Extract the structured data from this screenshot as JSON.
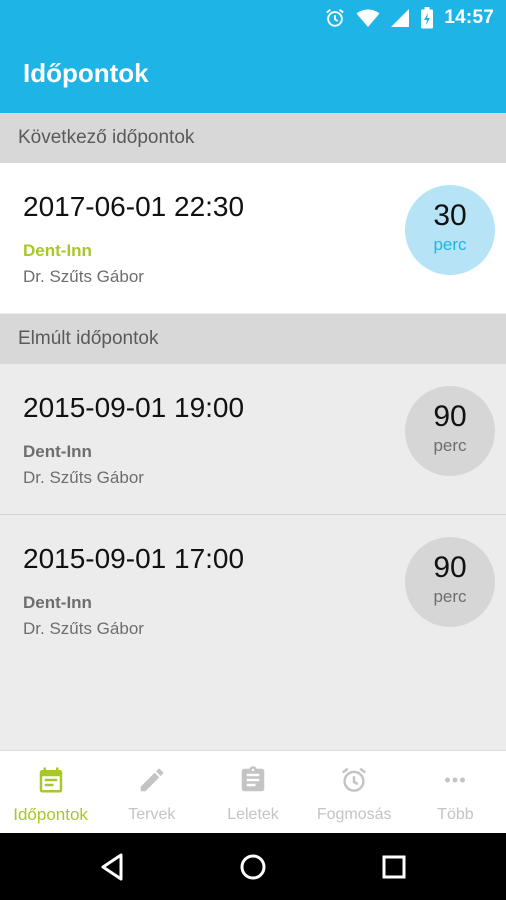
{
  "status_bar": {
    "time": "14:57",
    "icons": [
      "alarm-icon",
      "wifi-icon",
      "signal-icon",
      "battery-charging-icon"
    ]
  },
  "app_bar": {
    "title": "Időpontok"
  },
  "sections": {
    "upcoming": {
      "header": "Következő időpontok"
    },
    "past": {
      "header": "Elmúlt időpontok"
    }
  },
  "appointments": {
    "upcoming": [
      {
        "datetime": "2017-06-01 22:30",
        "clinic": "Dent-Inn",
        "doctor": "Dr. Szűts Gábor",
        "duration": "30",
        "unit": "perc"
      }
    ],
    "past": [
      {
        "datetime": "2015-09-01 19:00",
        "clinic": "Dent-Inn",
        "doctor": "Dr. Szűts Gábor",
        "duration": "90",
        "unit": "perc"
      },
      {
        "datetime": "2015-09-01 17:00",
        "clinic": "Dent-Inn",
        "doctor": "Dr. Szűts Gábor",
        "duration": "90",
        "unit": "perc"
      }
    ]
  },
  "bottom_nav": {
    "items": [
      {
        "label": "Időpontok",
        "icon": "calendar-icon",
        "active": true
      },
      {
        "label": "Tervek",
        "icon": "pencil-icon",
        "active": false
      },
      {
        "label": "Leletek",
        "icon": "clipboard-icon",
        "active": false
      },
      {
        "label": "Fogmosás",
        "icon": "alarm-clock-icon",
        "active": false
      },
      {
        "label": "Több",
        "icon": "more-icon",
        "active": false
      }
    ]
  },
  "system_nav": {
    "buttons": [
      "back-icon",
      "home-icon",
      "recents-icon"
    ]
  },
  "colors": {
    "primary": "#1fb4e6",
    "accent": "#a8c82a",
    "upcoming_circle": "#b6e4f6",
    "past_circle": "#d6d6d6"
  }
}
